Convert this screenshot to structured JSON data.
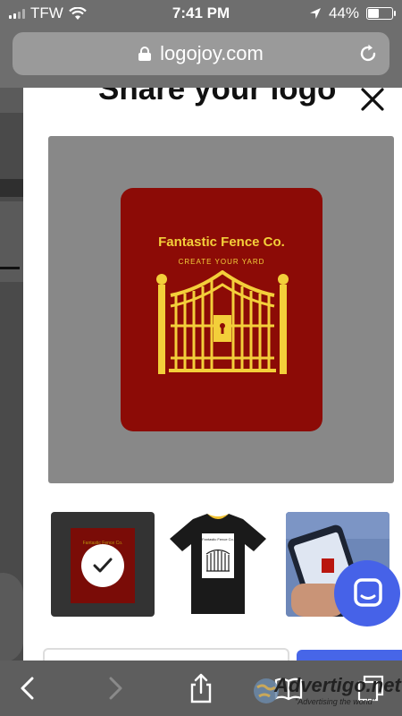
{
  "status": {
    "carrier": "TFW",
    "time": "7:41 PM",
    "battery": "44%",
    "battery_level": 0.44
  },
  "browser": {
    "url": "logojoy.com"
  },
  "modal": {
    "title": "Share your logo",
    "logo": {
      "company": "Fantastic Fence Co.",
      "slogan": "CREATE YOUR YARD",
      "bg_color": "#8c0b06",
      "accent_color": "#f3cf3a"
    },
    "mockup_company": "Fantastic Fence Co.",
    "tshirt_company": "Fantastic Fence Co."
  },
  "watermark": {
    "brand": "Advertigo.net",
    "tagline": "\"Advertising the world\""
  },
  "icons": [
    "signal-icon",
    "wifi-icon",
    "location-arrow-icon",
    "battery-icon",
    "lock-icon",
    "reload-icon",
    "close-icon",
    "check-icon",
    "chat-icon",
    "back-icon",
    "forward-icon",
    "share-icon",
    "bookmarks-icon",
    "tabs-icon"
  ]
}
